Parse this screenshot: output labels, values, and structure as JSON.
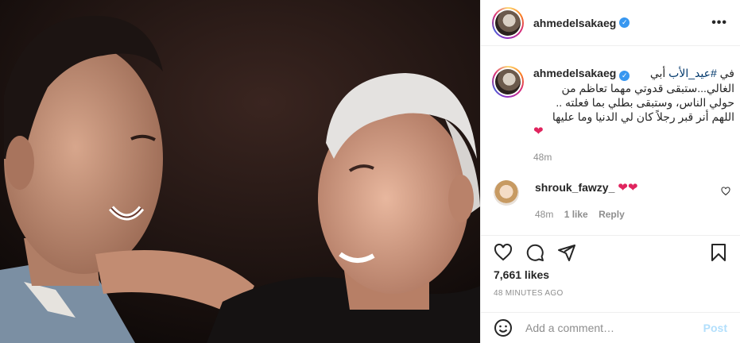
{
  "header": {
    "username": "ahmedelsakaeg",
    "more_label": "•••"
  },
  "caption": {
    "username": "ahmedelsakaeg",
    "hashtag": "#عيد_الأب",
    "text_prefix": "في ",
    "text_after_hashtag": " أبي",
    "line2": "الغالي...ستبقى قدوتي مهما تعاظم من",
    "line3": "حولي الناس، وستبقى بطلي بما فعلته ..",
    "line4": "اللهم أنر قبر رجلاً كان لي الدنيا وما عليها",
    "heart": "❤",
    "time": "48m"
  },
  "comment": {
    "username": "shrouk_fawzy_",
    "text": "❤❤",
    "time": "48m",
    "likes": "1 like",
    "reply": "Reply"
  },
  "likes_count": "7,661 likes",
  "post_time": "48 MINUTES AGO",
  "add_comment": {
    "placeholder": "Add a comment…",
    "post_label": "Post"
  },
  "icons": {
    "like": "heart-icon",
    "comment": "comment-icon",
    "share": "share-icon",
    "save": "bookmark-icon",
    "emoji": "emoji-icon",
    "verified": "verified-badge-icon"
  },
  "colors": {
    "verified_blue": "#3897f0",
    "heart_red": "#e0245e",
    "hashtag": "#00376b",
    "post_button_disabled": "#b2dffc",
    "secondary_text": "#8e8e8e"
  }
}
